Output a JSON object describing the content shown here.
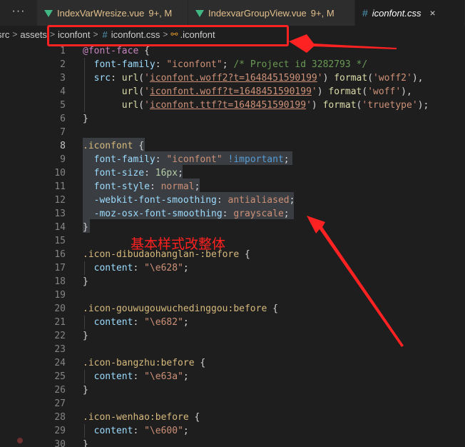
{
  "tabs": {
    "more_icon_text": "···",
    "items": [
      {
        "name": "IndexVarWresize.vue",
        "badge": "9+, M"
      },
      {
        "name": "IndexvarGroupView.vue",
        "badge": "9+, M"
      },
      {
        "name": "iconfont.css",
        "close": "×"
      }
    ]
  },
  "breadcrumb": {
    "items": [
      "src",
      "assets",
      "iconfont",
      "iconfont.css",
      ".iconfont"
    ],
    "separator": ">"
  },
  "annotation": {
    "text": "基本样式改整体",
    "color": "#ff2020"
  },
  "editor": {
    "lines": [
      {
        "n": "1",
        "text": "@font-face {"
      },
      {
        "n": "2",
        "text": "  font-family: \"iconfont\"; /* Project id 3282793 */"
      },
      {
        "n": "3",
        "text": "  src: url('iconfont.woff2?t=1648451590199') format('woff2'),"
      },
      {
        "n": "4",
        "text": "       url('iconfont.woff?t=1648451590199') format('woff'),"
      },
      {
        "n": "5",
        "text": "       url('iconfont.ttf?t=1648451590199') format('truetype');"
      },
      {
        "n": "6",
        "text": "}"
      },
      {
        "n": "7",
        "text": ""
      },
      {
        "n": "8",
        "text": ".iconfont {"
      },
      {
        "n": "9",
        "text": "  font-family: \"iconfont\" !important;"
      },
      {
        "n": "10",
        "text": "  font-size: 16px;"
      },
      {
        "n": "11",
        "text": "  font-style: normal;"
      },
      {
        "n": "12",
        "text": "  -webkit-font-smoothing: antialiased;"
      },
      {
        "n": "13",
        "text": "  -moz-osx-font-smoothing: grayscale;"
      },
      {
        "n": "14",
        "text": "}"
      },
      {
        "n": "15",
        "text": ""
      },
      {
        "n": "16",
        "text": ".icon-dibudaohanglan-:before {"
      },
      {
        "n": "17",
        "text": "  content: \"\\e628\";"
      },
      {
        "n": "18",
        "text": "}"
      },
      {
        "n": "19",
        "text": ""
      },
      {
        "n": "20",
        "text": ".icon-gouwugouwuchedinggou:before {"
      },
      {
        "n": "21",
        "text": "  content: \"\\e682\";"
      },
      {
        "n": "22",
        "text": "}"
      },
      {
        "n": "23",
        "text": ""
      },
      {
        "n": "24",
        "text": ".icon-bangzhu:before {"
      },
      {
        "n": "25",
        "text": "  content: \"\\e63a\";"
      },
      {
        "n": "26",
        "text": "}"
      },
      {
        "n": "27",
        "text": ""
      },
      {
        "n": "28",
        "text": ".icon-wenhao:before {"
      },
      {
        "n": "29",
        "text": "  content: \"\\e600\";"
      },
      {
        "n": "30",
        "text": "}"
      }
    ]
  },
  "colors": {
    "editor_bg": "#1e1e1e",
    "tab_bar_bg": "#252526",
    "vue_icon": "#41b883",
    "css_icon": "#519aba",
    "modified": "#e2c08d",
    "annotation_red": "#ff2222"
  },
  "icons": [
    "more-icon",
    "vue-file-icon",
    "css-hash-icon",
    "close-icon",
    "symbol-class-icon",
    "breakpoint-icon"
  ]
}
